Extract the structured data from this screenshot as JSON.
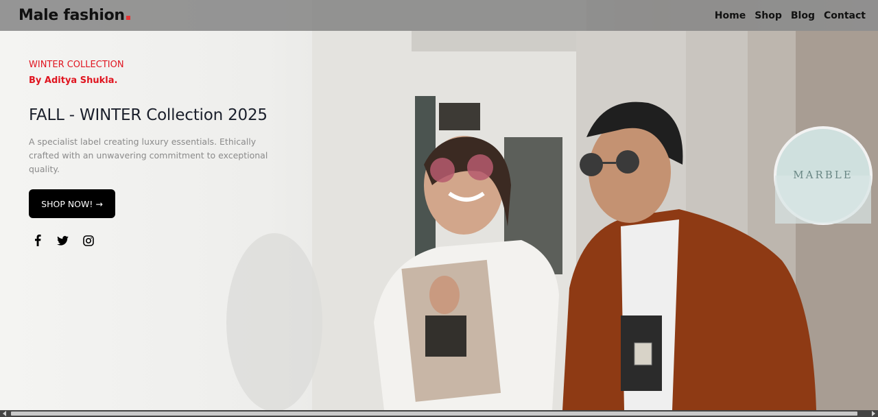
{
  "brand": {
    "logo_text": "Male fashion",
    "accent_color": "#e53637"
  },
  "nav": {
    "items": [
      {
        "label": "Home"
      },
      {
        "label": "Shop"
      },
      {
        "label": "Blog"
      },
      {
        "label": "Contact"
      }
    ]
  },
  "hero": {
    "eyebrow": "WINTER COLLECTION",
    "author": "By Aditya Shukla.",
    "title": "FALL - WINTER Collection 2025",
    "description": "A specialist label creating luxury essentials. Ethically crafted with an unwavering commitment to exceptional quality.",
    "cta_label": "SHOP NOW! →",
    "socials": [
      {
        "icon": "facebook-icon"
      },
      {
        "icon": "twitter-icon"
      },
      {
        "icon": "instagram-icon"
      }
    ],
    "image_alt_sign_text": "MARBLE",
    "highlight_color": "#e0141f"
  }
}
